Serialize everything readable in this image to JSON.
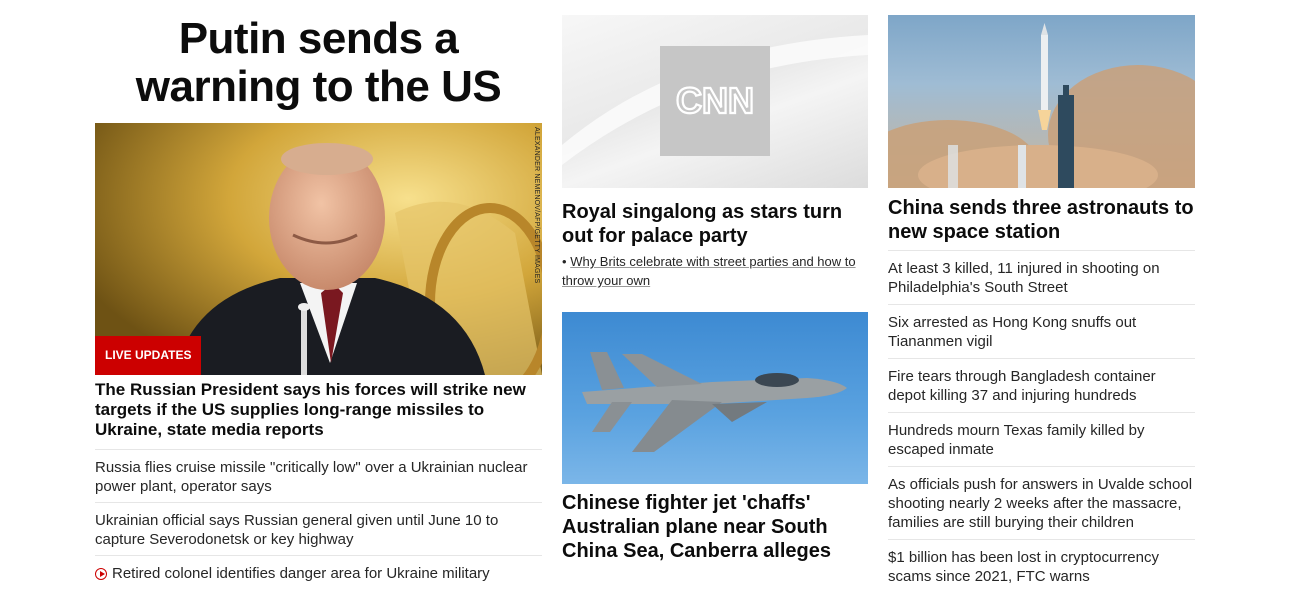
{
  "left": {
    "hero_title": "Putin sends a warning to the US",
    "image_credit": "ALEXANDER NEMENOV/AFP/GETTY IMAGES",
    "live_badge": "LIVE UPDATES",
    "hero_caption": "The Russian President says his forces will strike new targets if the US supplies long-range missiles to Ukraine, state media reports",
    "links": [
      "Russia flies cruise missile \"critically low\" over a Ukrainian nuclear power plant, operator says",
      "Ukrainian official says Russian general given until June 10 to capture Severodonetsk or key highway",
      "Retired colonel identifies danger area for Ukraine military"
    ]
  },
  "middle": {
    "logo_text": "CNN",
    "headline1": "Royal singalong as stars turn out for palace party",
    "sub_bullet": "•",
    "sub_link": "Why Brits celebrate with street parties and how to throw your own",
    "headline2": "Chinese fighter jet 'chaffs' Australian plane near South China Sea, Canberra alleges"
  },
  "right": {
    "headline": "China sends three astronauts to new space station",
    "links": [
      "At least 3 killed, 11 injured in shooting on Philadelphia's South Street",
      "Six arrested as Hong Kong snuffs out Tiananmen vigil",
      "Fire tears through Bangladesh container depot killing 37 and injuring hundreds",
      "Hundreds mourn Texas family killed by escaped inmate",
      "As officials push for answers in Uvalde school shooting nearly 2 weeks after the massacre, families are still burying their children",
      "$1 billion has been lost in cryptocurrency scams since 2021, FTC warns"
    ]
  },
  "icons": {
    "video_play": "play-circle-icon"
  },
  "colors": {
    "live_red": "#cc0000",
    "text": "#0c0c0c",
    "divider": "#e6e6e6"
  }
}
